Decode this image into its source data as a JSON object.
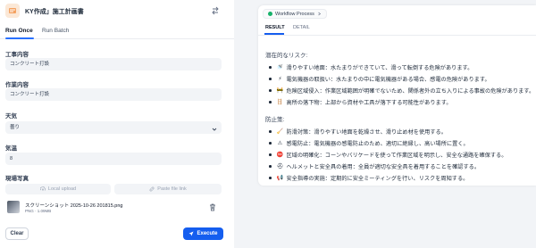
{
  "app": {
    "title": "KY作成」施工計画書"
  },
  "tabs": {
    "run_once": "Run Once",
    "run_batch": "Run Batch"
  },
  "form": {
    "fields": [
      {
        "label": "工事内容",
        "value": "コンクリート打設"
      },
      {
        "label": "作業内容",
        "value": "コンクリート打設"
      },
      {
        "label": "天気",
        "value": "曇り"
      },
      {
        "label": "気温",
        "value": "8"
      }
    ],
    "photo_label": "現場写真",
    "local_upload": "Local upload",
    "paste_link": "Paste file link",
    "file": {
      "name": "スクリーンショット 2025-10-26 201815.png",
      "meta": "PNG · 1.09MB"
    },
    "clear": "Clear",
    "execute": "Execute"
  },
  "result": {
    "workflow_label": "Workflow Process",
    "tab_result": "RESULT",
    "tab_detail": "DETAIL",
    "risks_title": "潜在的なリスク:",
    "risks": [
      {
        "icon": "🚿",
        "text": "滑りやすい地面：水たまりができていて、滑って転倒する危険があります。"
      },
      {
        "icon": "⚡",
        "text": "電気機器の取扱い：水たまりの中に電気機器がある場合、感電の危険があります。"
      },
      {
        "icon": "🚧",
        "text": "危険区域侵入：作業区域範囲が明確でないため、関係者外の立ち入りによる事故の危険があります。"
      },
      {
        "icon": "🪜",
        "text": "高所の落下物：上部から資材や工具が落下する可能性があります。"
      }
    ],
    "measures_title": "防止策:",
    "measures": [
      {
        "icon": "🧹",
        "text": "防滑対策：滑りやすい地面を乾燥させ、滑り止め材を使用する。"
      },
      {
        "icon": "⚠",
        "text": "感電防止：電気機器の感電防止のため、適切に絶縁し、高い場所に置く。"
      },
      {
        "icon": "⛔",
        "text": "区域の明確化：コーンやバリケードを使って作業区域を明示し、安全な通路を確保する。"
      },
      {
        "icon": "⛑",
        "text": "ヘルメットと安全具の着用：全員が適切な安全具を着用することを確認する。"
      },
      {
        "icon": "📢",
        "text": "安全指導の実施：定期的に安全ミーティングを行い、リスクを周知する。"
      }
    ]
  }
}
